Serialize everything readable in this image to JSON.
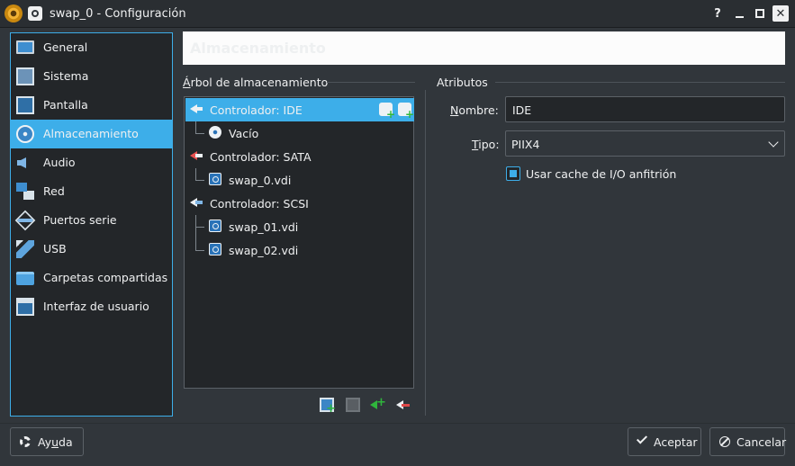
{
  "window": {
    "title": "swap_0 - Configuración",
    "help_glyph": "?",
    "close_glyph": "✕"
  },
  "sidebar": {
    "items": [
      {
        "label": "General",
        "icon": "monitor-icon"
      },
      {
        "label": "Sistema",
        "icon": "chip-icon"
      },
      {
        "label": "Pantalla",
        "icon": "display-icon"
      },
      {
        "label": "Almacenamiento",
        "icon": "storage-icon"
      },
      {
        "label": "Audio",
        "icon": "speaker-icon"
      },
      {
        "label": "Red",
        "icon": "network-icon"
      },
      {
        "label": "Puertos serie",
        "icon": "serial-port-icon"
      },
      {
        "label": "USB",
        "icon": "usb-icon"
      },
      {
        "label": "Carpetas compartidas",
        "icon": "folder-icon"
      },
      {
        "label": "Interfaz de usuario",
        "icon": "user-interface-icon"
      }
    ],
    "selected": "Almacenamiento"
  },
  "banner": {
    "title": "Almacenamiento"
  },
  "storage_tree": {
    "group_label_first": "Á",
    "group_label_rest": "rbol de almacenamiento",
    "rows": [
      {
        "label": "Controlador: IDE",
        "kind": "controller"
      },
      {
        "label": "Vacío",
        "kind": "optical"
      },
      {
        "label": "Controlador: SATA",
        "kind": "controller"
      },
      {
        "label": "swap_0.vdi",
        "kind": "disk"
      },
      {
        "label": "Controlador: SCSI",
        "kind": "controller"
      },
      {
        "label": "swap_01.vdi",
        "kind": "disk"
      },
      {
        "label": "swap_02.vdi",
        "kind": "disk"
      }
    ]
  },
  "attributes": {
    "group_label": "Atributos",
    "name_label_first": "N",
    "name_label_rest": "ombre:",
    "name_value": "IDE",
    "type_label_first": "T",
    "type_label_rest": "ipo:",
    "type_value": "PIIX4",
    "cache_label": "Usar cache de I/O anfitrión",
    "cache_checked": true
  },
  "footer": {
    "help_first": "Ay",
    "help_u": "u",
    "help_rest": "da",
    "ok_label": "Aceptar",
    "cancel_label": "Cancelar"
  },
  "colors": {
    "accent": "#3daee9",
    "background": "#31363b",
    "field": "#232629"
  }
}
